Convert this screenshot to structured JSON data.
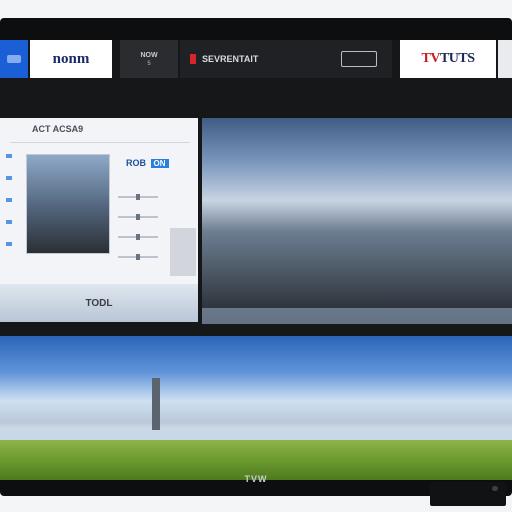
{
  "tiles": {
    "tile1_label": "nonm",
    "tile2_label": "NOW",
    "tile2_sub": "5",
    "tile3_label": "SEVRENTAIT",
    "tile4_label": "",
    "tile5_label_red": "TV",
    "tile5_label_dark": "TUTS"
  },
  "left_panel": {
    "heading": "ACT ACSA9",
    "right_label": "ROB",
    "right_pill": "ON",
    "footer_label": "TODL"
  },
  "tv": {
    "brand": "TVW"
  },
  "colors": {
    "accent_blue": "#1a5fd6",
    "brand_red": "#c81e1e",
    "bezel": "#0d0e10"
  }
}
